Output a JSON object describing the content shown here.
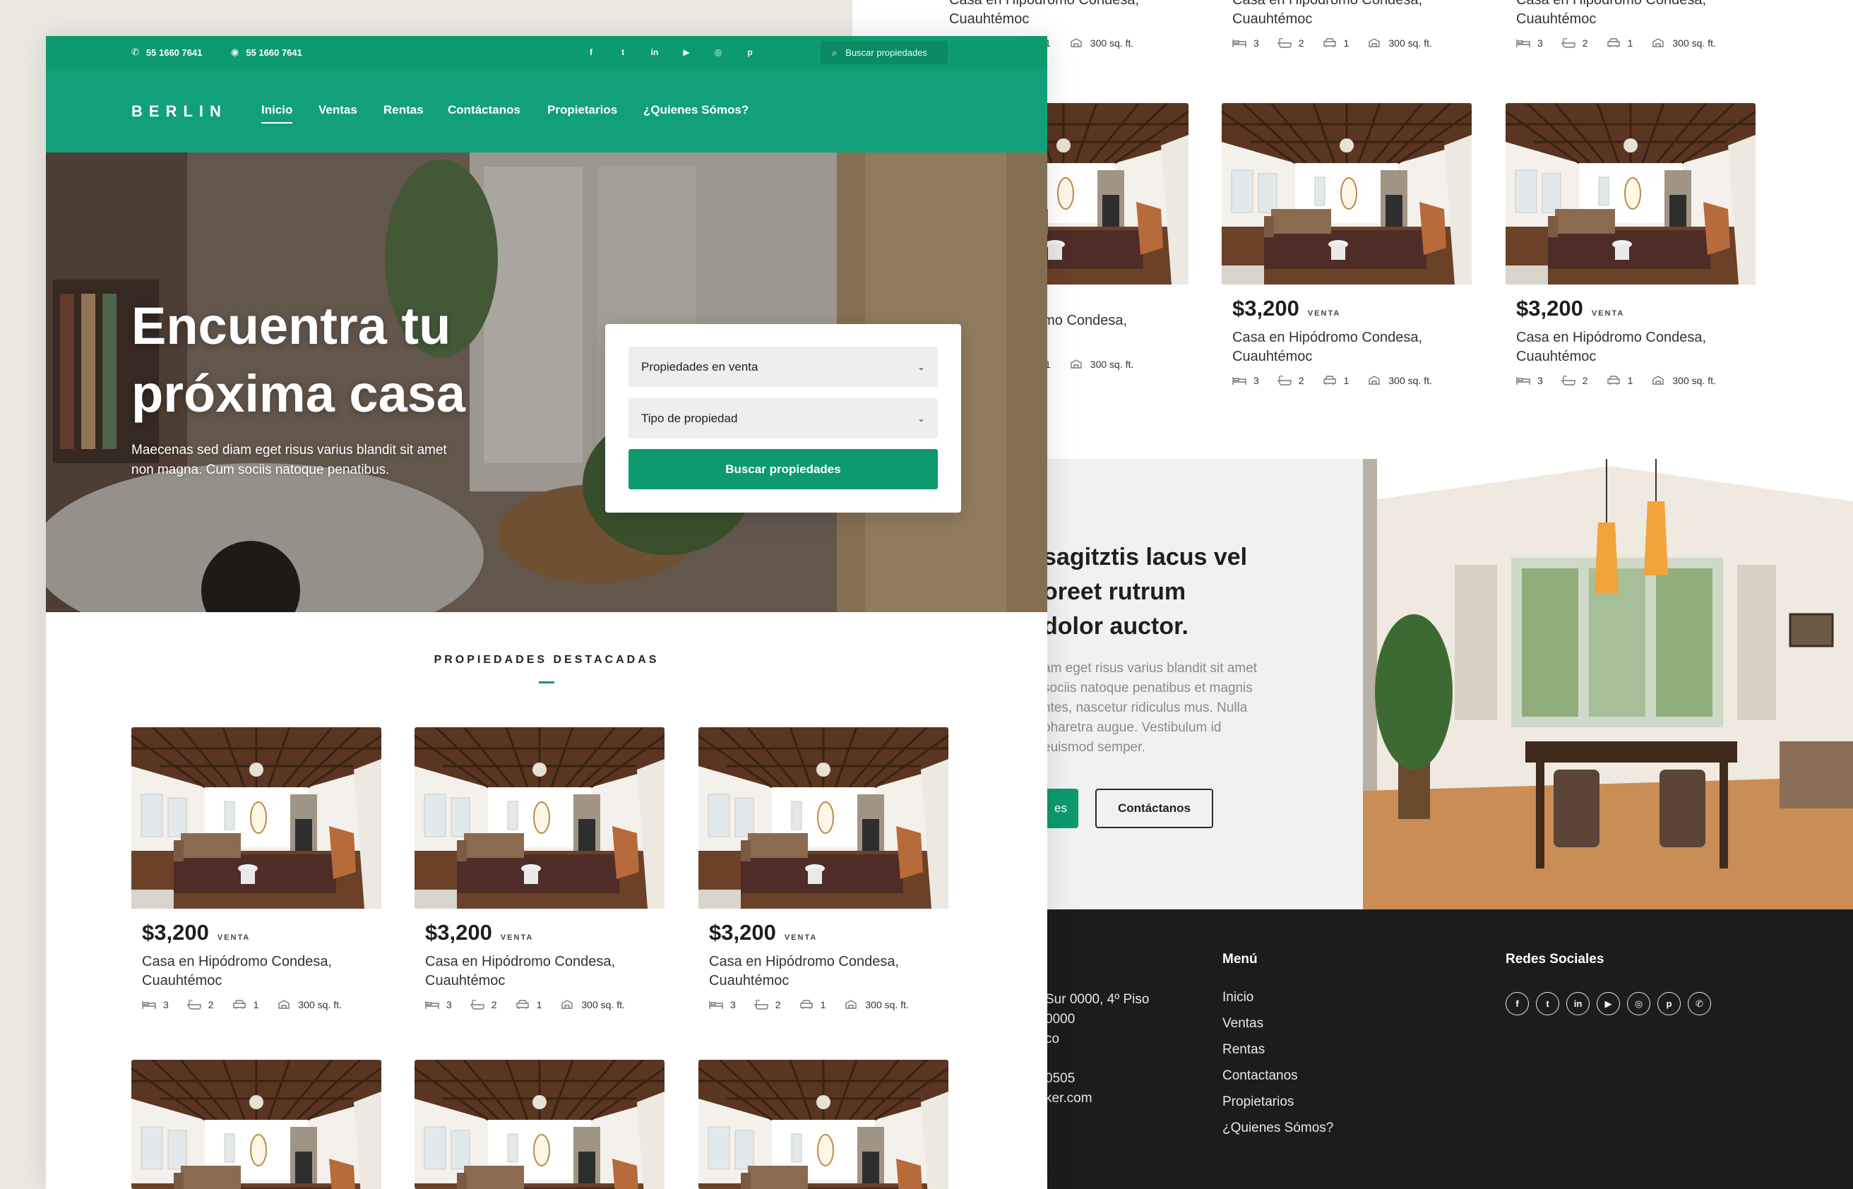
{
  "back_page": {
    "top_row_partial": [
      {
        "title": "Casa en Hipódromo Condesa, Cuauhtémoc",
        "beds": "",
        "baths": "",
        "parking": "1",
        "area": "300 sq. ft."
      },
      {
        "title": "Casa en Hipódromo Condesa, Cuauhtémoc",
        "beds": "3",
        "baths": "2",
        "parking": "1",
        "area": "300 sq. ft."
      },
      {
        "title": "Casa en Hipódromo Condesa, Cuauhtémoc",
        "beds": "3",
        "baths": "2",
        "parking": "1",
        "area": "300 sq. ft."
      }
    ],
    "cards": [
      {
        "price": "",
        "tag": "TA",
        "title": "omo Condesa,",
        "beds": "",
        "baths": "",
        "parking": "1",
        "area": "300 sq. ft."
      },
      {
        "price": "$3,200",
        "tag": "VENTA",
        "title": "Casa en Hipódromo Condesa, Cuauhtémoc",
        "beds": "3",
        "baths": "2",
        "parking": "1",
        "area": "300 sq. ft."
      },
      {
        "price": "$3,200",
        "tag": "VENTA",
        "title": "Casa en Hipódromo Condesa, Cuauhtémoc",
        "beds": "3",
        "baths": "2",
        "parking": "1",
        "area": "300 sq. ft."
      }
    ],
    "about": {
      "heading_lines": [
        "sagitztis lacus vel",
        "oreet rutrum",
        "dolor auctor."
      ],
      "text_lines": [
        "am eget risus varius blandit sit amet",
        "sociis natoque penatibus et magnis",
        "ntes, nascetur ridiculus mus. Nulla",
        "pharetra augue. Vestibulum id",
        "euismod semper."
      ],
      "primary_button": "es",
      "contact_button": "Contáctanos"
    },
    "footer": {
      "address_lines": [
        "Sur 0000, 4º Piso",
        "0000",
        "co"
      ],
      "contact_lines": [
        "0505",
        "ker.com"
      ],
      "menu_title": "Menú",
      "menu_items": [
        "Inicio",
        "Ventas",
        "Rentas",
        "Contactanos",
        "Propietarios",
        "¿Quienes Sómos?"
      ],
      "social_title": "Redes Sociales",
      "social_icons": [
        "facebook-icon",
        "twitter-icon",
        "linkedin-icon",
        "youtube-icon",
        "instagram-icon",
        "pinterest-icon",
        "whatsapp-icon"
      ]
    }
  },
  "front_page": {
    "topbar": {
      "phone1": "55 1660 7641",
      "phone2": "55 1660 7641",
      "social_icons": [
        "facebook-icon",
        "twitter-icon",
        "linkedin-icon",
        "youtube-icon",
        "instagram-icon",
        "pinterest-icon"
      ],
      "search_placeholder": "Buscar propiedades"
    },
    "nav": {
      "logo": "BERLIN",
      "items": [
        "Inicio",
        "Ventas",
        "Rentas",
        "Contáctanos",
        "Propietarios",
        "¿Quienes Sómos?"
      ],
      "active": "Inicio"
    },
    "hero": {
      "title_line1": "Encuentra tu",
      "title_line2": "próxima casa",
      "text_line1": "Maecenas sed diam eget risus varius blandit sit amet",
      "text_line2": "non magna. Cum sociis natoque penatibus."
    },
    "search_card": {
      "select1": "Propiedades en venta",
      "select2": "Tipo de propiedad",
      "button": "Buscar propiedades"
    },
    "featured": {
      "title": "PROPIEDADES DESTACADAS",
      "cards": [
        {
          "price": "$3,200",
          "tag": "VENTA",
          "title": "Casa en Hipódromo Condesa, Cuauhtémoc",
          "beds": "3",
          "baths": "2",
          "parking": "1",
          "area": "300 sq. ft."
        },
        {
          "price": "$3,200",
          "tag": "VENTA",
          "title": "Casa en Hipódromo Condesa, Cuauhtémoc",
          "beds": "3",
          "baths": "2",
          "parking": "1",
          "area": "300 sq. ft."
        },
        {
          "price": "$3,200",
          "tag": "VENTA",
          "title": "Casa en Hipódromo Condesa, Cuauhtémoc",
          "beds": "3",
          "baths": "2",
          "parking": "1",
          "area": "300 sq. ft."
        }
      ]
    }
  },
  "colors": {
    "brand_green": "#0d9a6f",
    "nav_green": "#11a07a",
    "footer_dark": "#1c1c1c"
  }
}
